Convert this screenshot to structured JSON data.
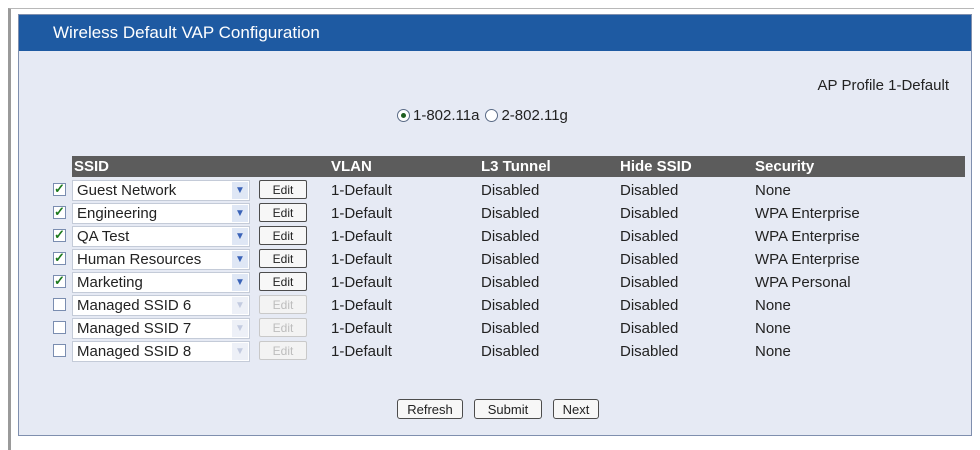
{
  "panel": {
    "title": "Wireless Default VAP Configuration"
  },
  "profile_label": "AP Profile 1-Default",
  "radios": [
    {
      "label": "1-802.11a",
      "selected": true
    },
    {
      "label": "2-802.11g",
      "selected": false
    }
  ],
  "table": {
    "headers": {
      "ssid": "SSID",
      "vlan": "VLAN",
      "l3": "L3 Tunnel",
      "hide": "Hide SSID",
      "security": "Security"
    },
    "rows": [
      {
        "enabled": true,
        "ssid": "Guest Network",
        "edit": "Edit",
        "vlan": "1-Default",
        "l3": "Disabled",
        "hide": "Disabled",
        "security": "None"
      },
      {
        "enabled": true,
        "ssid": "Engineering",
        "edit": "Edit",
        "vlan": "1-Default",
        "l3": "Disabled",
        "hide": "Disabled",
        "security": "WPA Enterprise"
      },
      {
        "enabled": true,
        "ssid": "QA Test",
        "edit": "Edit",
        "vlan": "1-Default",
        "l3": "Disabled",
        "hide": "Disabled",
        "security": "WPA Enterprise"
      },
      {
        "enabled": true,
        "ssid": "Human Resources",
        "edit": "Edit",
        "vlan": "1-Default",
        "l3": "Disabled",
        "hide": "Disabled",
        "security": "WPA Enterprise"
      },
      {
        "enabled": true,
        "ssid": "Marketing",
        "edit": "Edit",
        "vlan": "1-Default",
        "l3": "Disabled",
        "hide": "Disabled",
        "security": "WPA Personal"
      },
      {
        "enabled": false,
        "ssid": "Managed SSID 6",
        "edit": "Edit",
        "vlan": "1-Default",
        "l3": "Disabled",
        "hide": "Disabled",
        "security": "None"
      },
      {
        "enabled": false,
        "ssid": "Managed SSID 7",
        "edit": "Edit",
        "vlan": "1-Default",
        "l3": "Disabled",
        "hide": "Disabled",
        "security": "None"
      },
      {
        "enabled": false,
        "ssid": "Managed SSID 8",
        "edit": "Edit",
        "vlan": "1-Default",
        "l3": "Disabled",
        "hide": "Disabled",
        "security": "None"
      }
    ]
  },
  "buttons": {
    "refresh": "Refresh",
    "submit": "Submit",
    "next": "Next"
  },
  "colors": {
    "header_bar": "#1e5aa2",
    "panel_bg": "#e6eaf4",
    "table_header": "#5c5c5c",
    "check": "#1e7a1e"
  },
  "icons": {
    "dropdown": "chevron-down-icon",
    "checkbox": "checkmark-icon",
    "radio": "radio-icon"
  }
}
